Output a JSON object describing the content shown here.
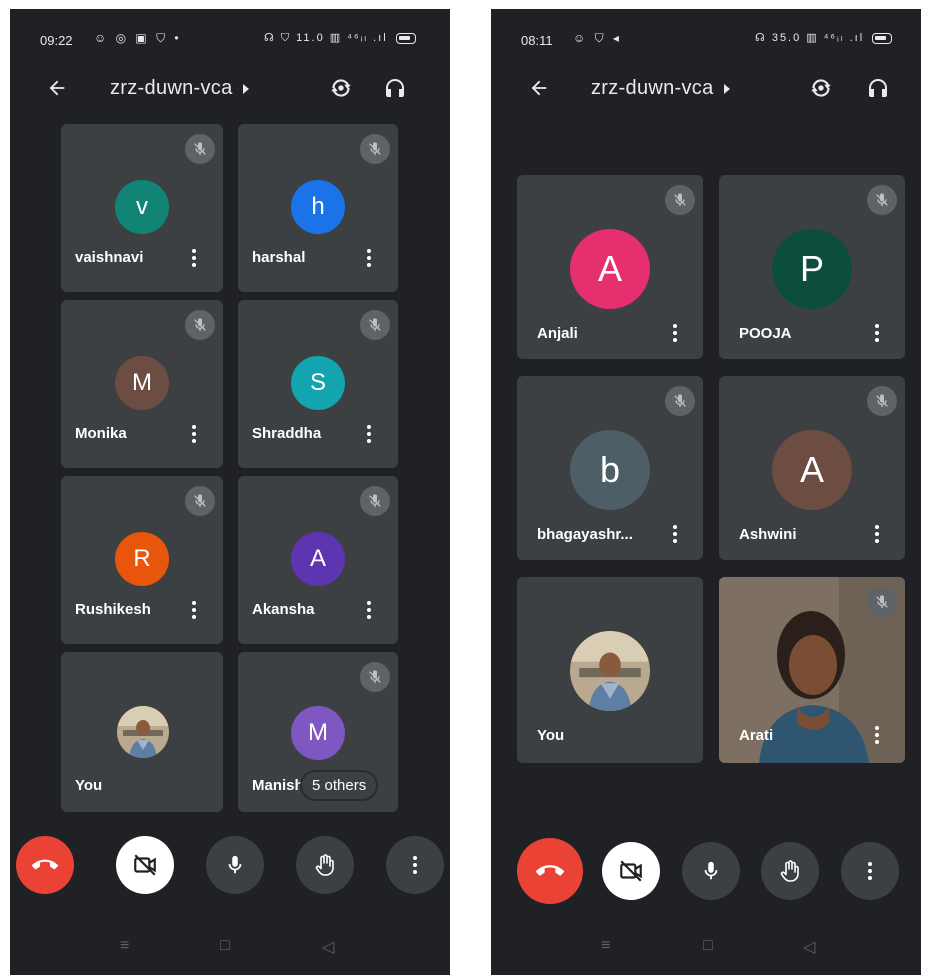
{
  "left_phone": {
    "status": {
      "time": "09:22",
      "left_icons": "☺ ◎ ▣ ⛉ •",
      "right_icons": "☊ ⛉ 11.0 ▥ ⁴⁶ᵢₗ .ıl"
    },
    "meeting_code": "zrz-duwn-vca",
    "tiles": [
      {
        "name": "vaishnavi",
        "initial": "v",
        "color": "#128476"
      },
      {
        "name": "harshal",
        "initial": "h",
        "color": "#1a73e8"
      },
      {
        "name": "Monika",
        "initial": "M",
        "color": "#6d4c41"
      },
      {
        "name": "Shraddha",
        "initial": "S",
        "color": "#12a4af"
      },
      {
        "name": "Rushikesh",
        "initial": "R",
        "color": "#e8560c"
      },
      {
        "name": "Akansha",
        "initial": "A",
        "color": "#5e35b1"
      },
      {
        "name": "You",
        "initial": ""
      },
      {
        "name": "Manish",
        "initial": "M",
        "color": "#7e57c2"
      }
    ],
    "others_label": "5 others"
  },
  "right_phone": {
    "status": {
      "time": "08:11",
      "left_icons": "☺ ⛉ ◂",
      "right_icons": "☊ 35.0 ▥ ⁴⁶ᵢₗ .ıl"
    },
    "meeting_code": "zrz-duwn-vca",
    "tiles": [
      {
        "name": "Anjali",
        "initial": "A",
        "color": "#e52f6f"
      },
      {
        "name": "POOJA",
        "initial": "P",
        "color": "#0c4d3b"
      },
      {
        "name": "bhagayashr...",
        "initial": "b",
        "color": "#4e5e67"
      },
      {
        "name": "Ashwini",
        "initial": "A",
        "color": "#6d4c41"
      },
      {
        "name": "You",
        "initial": ""
      },
      {
        "name": "Arati",
        "initial": ""
      }
    ]
  },
  "controls": {
    "end_call": "end-call",
    "camera": "camera-off",
    "mic": "microphone",
    "hand": "raise-hand",
    "more": "more-options"
  },
  "icons": {
    "back": "back-arrow-icon",
    "switch_camera": "switch-camera-icon",
    "audio": "headphones-icon",
    "muted": "mic-off-icon"
  }
}
